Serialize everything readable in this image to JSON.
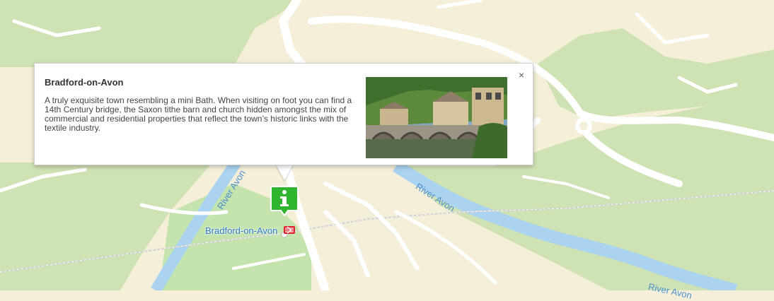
{
  "map": {
    "river_labels": [
      "River Avon",
      "River Avon",
      "River Avon"
    ],
    "station_label": "Bradford-on-Avon",
    "icons": {
      "marker": "info-marker-icon",
      "station": "national-rail-icon",
      "close": "close-icon"
    },
    "colors": {
      "land": "#f5efd9",
      "park": "#cfe2b4",
      "park_light": "#bfe3a8",
      "water": "#aad3ef",
      "road": "#ffffff",
      "marker": "#2fb52f",
      "rail_icon": "#e0202a"
    }
  },
  "info_window": {
    "title": "Bradford-on-Avon",
    "description": "A truly exquisite town resembling a mini Bath. When visiting on foot you can find a 14th Century bridge, the Saxon tithe barn and church hidden amongst the mix of commercial and residential properties that reflect the town’s historic links with the textile industry.",
    "close_label": "×"
  }
}
